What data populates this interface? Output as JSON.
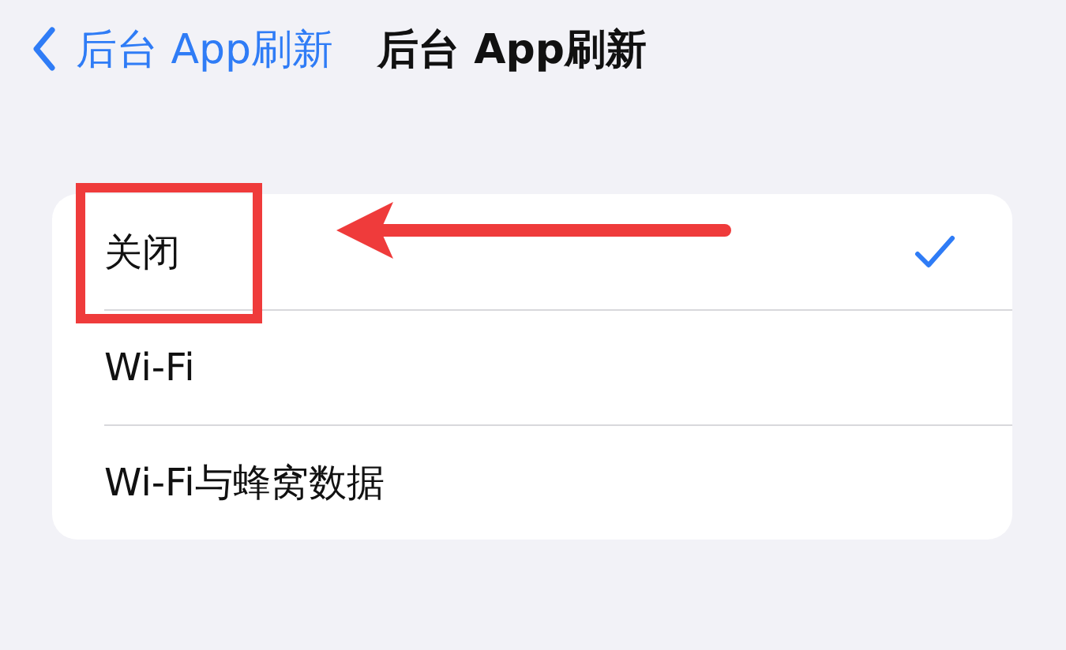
{
  "nav": {
    "back_label": "后台 App刷新",
    "title": "后台 App刷新"
  },
  "options": [
    {
      "label": "关闭",
      "selected": true,
      "highlighted": true
    },
    {
      "label": "Wi-Fi",
      "selected": false,
      "highlighted": false
    },
    {
      "label": "Wi-Fi与蜂窝数据",
      "selected": false,
      "highlighted": false
    }
  ]
}
